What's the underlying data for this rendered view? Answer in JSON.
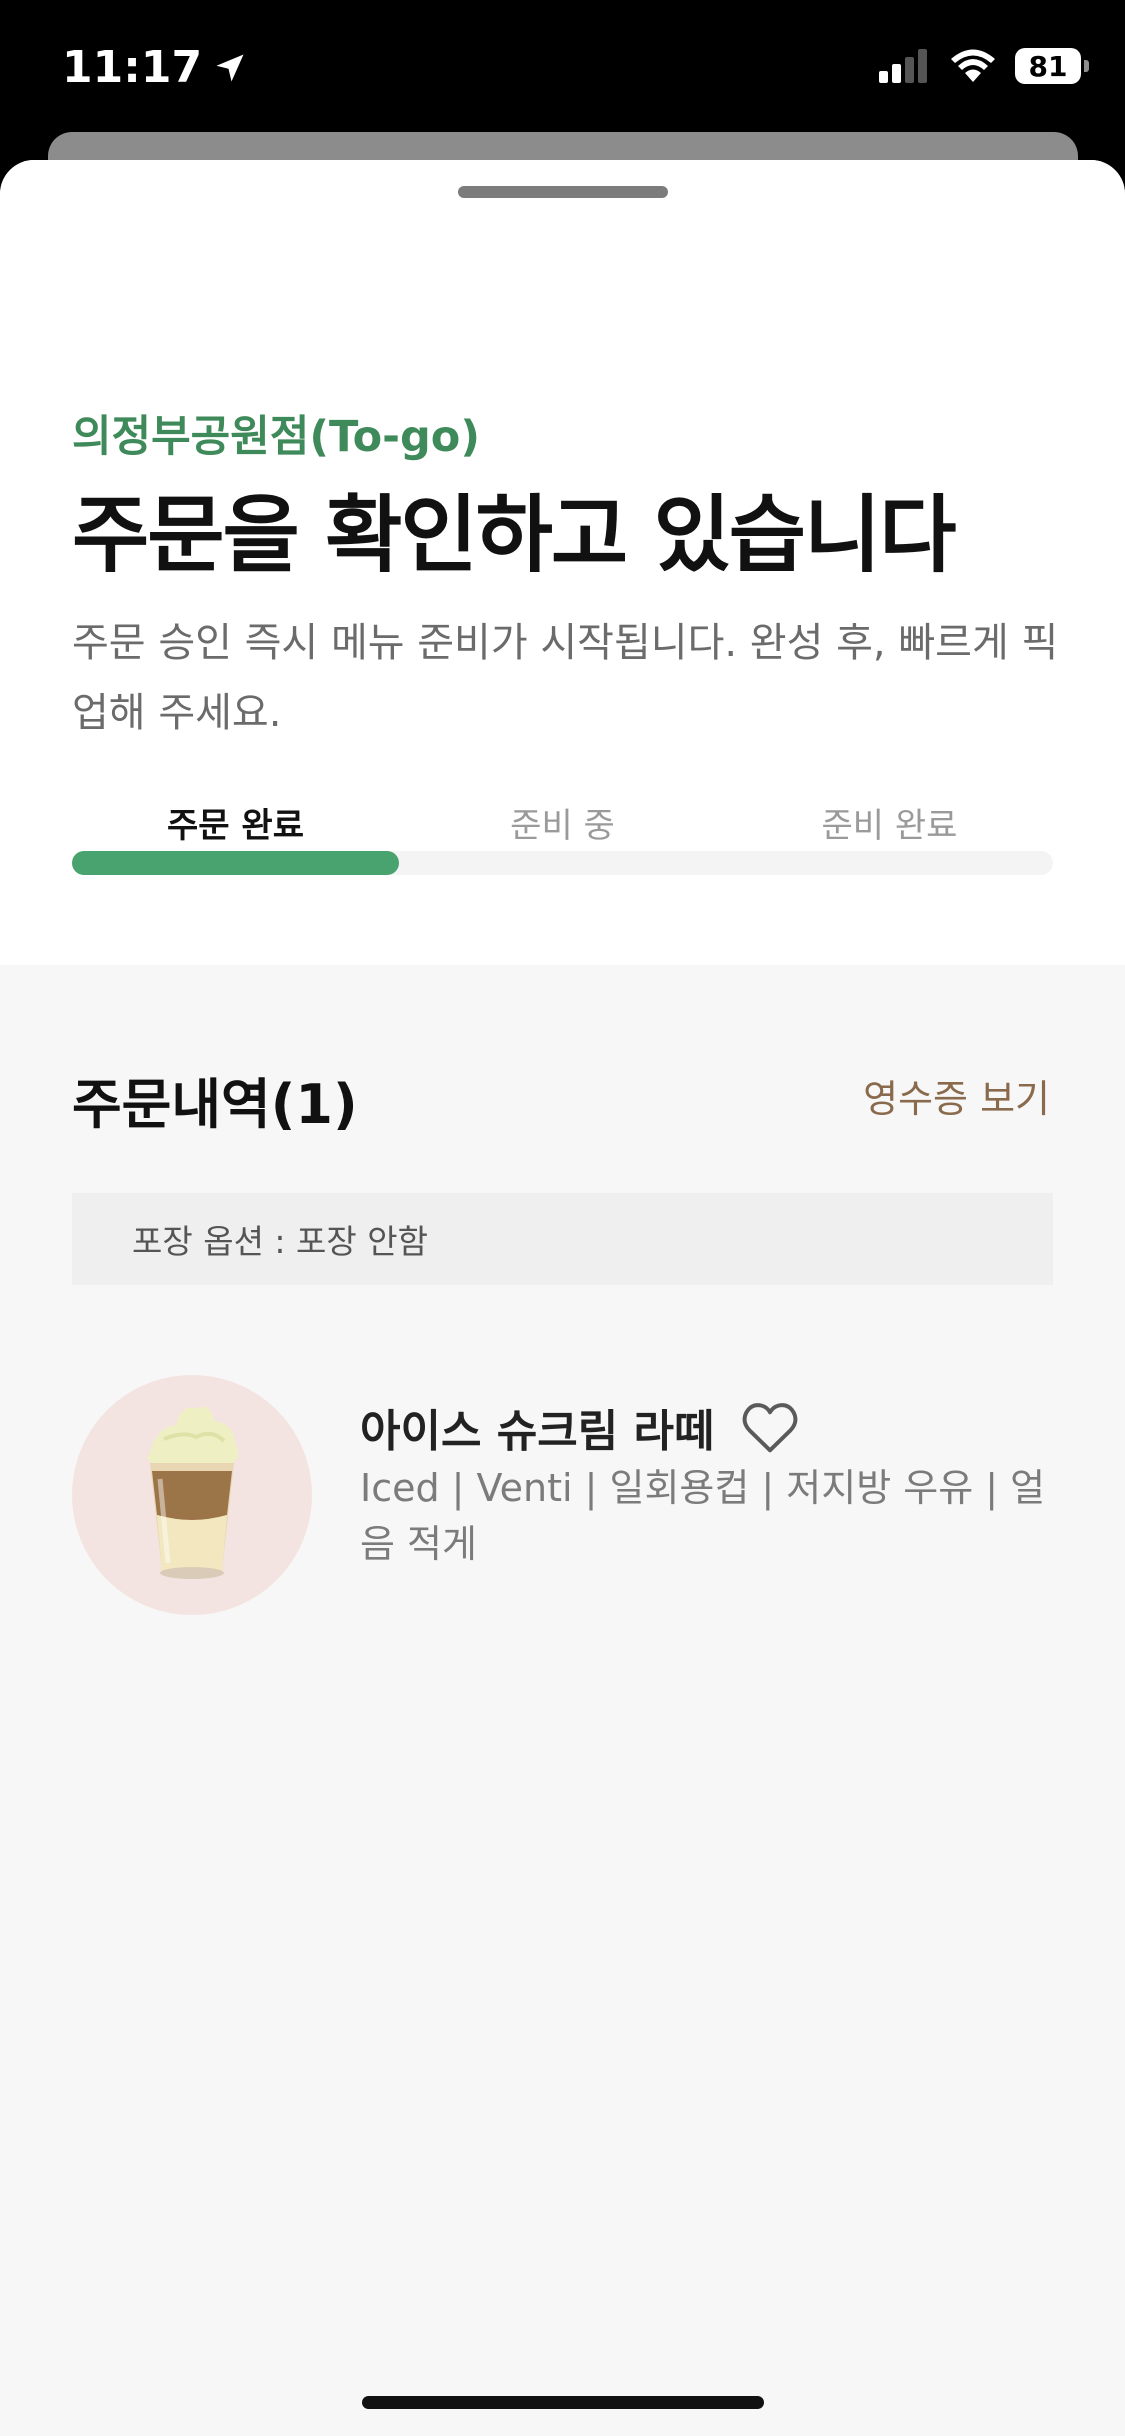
{
  "status_bar": {
    "time": "11:17",
    "battery": "81",
    "icons": [
      "location-arrow-icon",
      "cellular-signal-icon",
      "wifi-icon",
      "battery-icon"
    ]
  },
  "header": {
    "store_name": "의정부공원점(To-go)",
    "headline": "주문을 확인하고 있습니다",
    "description": "주문 승인 즉시 메뉴 준비가 시작됩니다. 완성 후, 빠르게 픽업해 주세요."
  },
  "progress": {
    "steps": [
      {
        "label": "주문 완료",
        "active": true
      },
      {
        "label": "준비 중",
        "active": false
      },
      {
        "label": "준비 완료",
        "active": false
      }
    ],
    "fraction": 0.3333
  },
  "order": {
    "title": "주문내역(1)",
    "receipt_label": "영수증 보기",
    "packaging": "포장 옵션 : 포장 안함",
    "items": [
      {
        "name": "아이스 슈크림 라떼",
        "options": "Iced | Venti | 일회용컵 | 저지방 우유 | 얼음 적게",
        "icon": "heart-outline-icon"
      }
    ]
  },
  "colors": {
    "brand_green": "#3f8a5a",
    "progress_green": "#48a36e",
    "link_brown": "#8a6a4c"
  }
}
